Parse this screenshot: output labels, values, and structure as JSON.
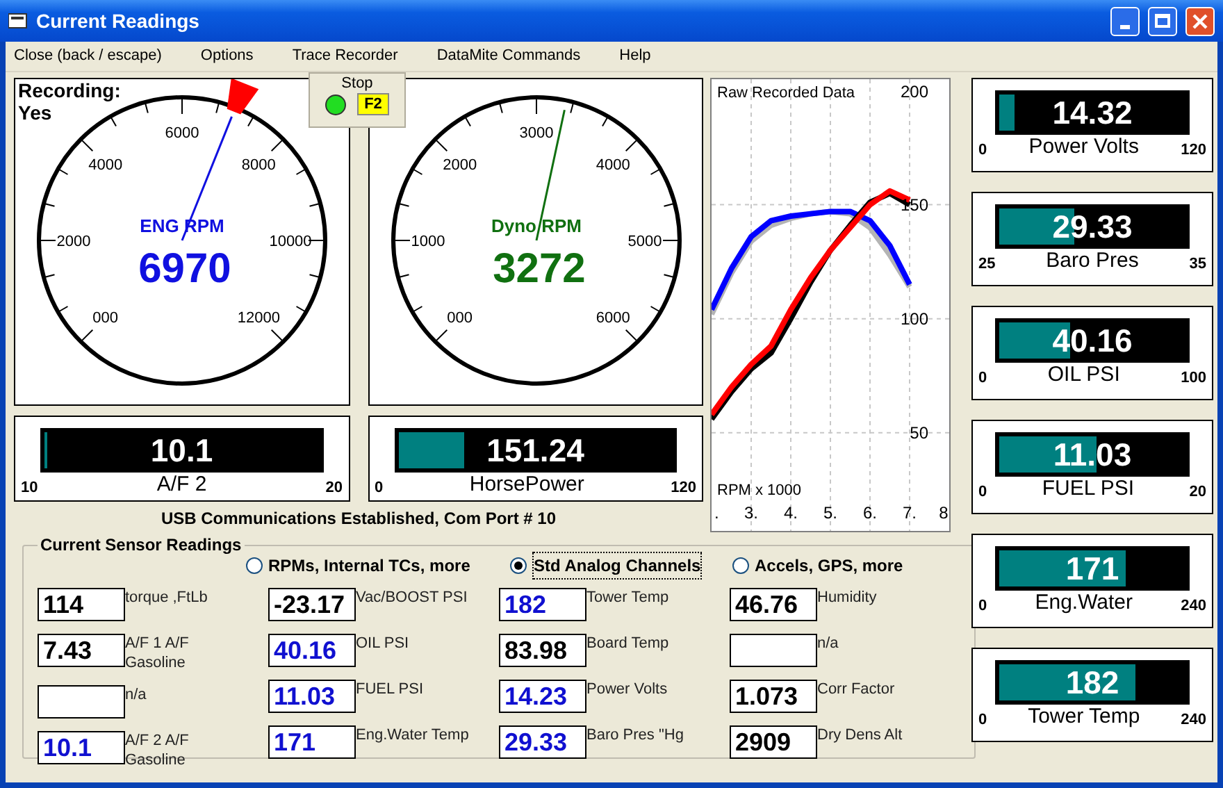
{
  "window": {
    "title": "Current Readings"
  },
  "menu": [
    "Close (back / escape)",
    "Options",
    "Trace Recorder",
    "DataMite Commands",
    "Help"
  ],
  "recorder_popup": {
    "label": "Stop",
    "running": true,
    "key": "F2"
  },
  "gauges": [
    {
      "label": "ENG RPM",
      "value": "6970",
      "color": "#1010e0",
      "level": 0.581,
      "marker": true,
      "status_label": "Recording:",
      "status_value": "Yes",
      "tick_labels": [
        "000",
        "2000",
        "4000",
        "6000",
        "8000",
        "10000",
        "12000"
      ]
    },
    {
      "label": "Dyno RPM",
      "value": "3272",
      "color": "#107010",
      "level": 0.545,
      "marker": false,
      "tick_labels": [
        "000",
        "1000",
        "2000",
        "3000",
        "4000",
        "5000",
        "6000"
      ]
    }
  ],
  "bars": [
    {
      "label": "A/F 2",
      "value": "10.1",
      "min": "10",
      "max": "20",
      "level": 0.01
    },
    {
      "label": "HorsePower",
      "value": "151.24",
      "min": "0",
      "max": "120",
      "level": 0.24
    }
  ],
  "status_text": "USB Communications Established, Com Port # 10",
  "chart": {
    "chart_data": {
      "type": "line",
      "title": "Raw Recorded Data",
      "xlabel": "RPM x 1000",
      "x": [
        2,
        2.5,
        3,
        3.5,
        4,
        4.5,
        5,
        5.5,
        6,
        6.5,
        7
      ],
      "xlim": [
        2,
        8
      ],
      "ylim": [
        7,
        205
      ],
      "grid": true,
      "xticks": [
        {
          "value": 2,
          "label": "."
        },
        {
          "value": 3,
          "label": "3."
        },
        {
          "value": 4,
          "label": "4."
        },
        {
          "value": 5,
          "label": "5."
        },
        {
          "value": 6,
          "label": "6."
        },
        {
          "value": 7,
          "label": "7."
        },
        {
          "value": 8,
          "label": "8"
        }
      ],
      "yticks": [
        50,
        100,
        150,
        200
      ],
      "series": [
        {
          "color": "#b4b4b4",
          "values": [
            102,
            120,
            134,
            141,
            144,
            146,
            147,
            146,
            140,
            128,
            114
          ]
        },
        {
          "color": "#0000ff",
          "values": [
            104,
            122,
            136,
            143,
            145,
            146,
            147,
            147,
            143,
            132,
            115
          ]
        },
        {
          "color": "#000000",
          "values": [
            56,
            68,
            78,
            85,
            100,
            116,
            130,
            141,
            151,
            155,
            150
          ]
        },
        {
          "color": "#ff0000",
          "values": [
            58,
            70,
            80,
            88,
            104,
            118,
            130,
            140,
            150,
            156,
            152
          ]
        }
      ]
    }
  },
  "sensor_readings": {
    "title": "Current Sensor Readings",
    "options": [
      {
        "label": "RPMs, Internal TCs, more",
        "selected": false
      },
      {
        "label": "Std Analog Channels",
        "selected": true
      },
      {
        "label": "Accels, GPS, more",
        "selected": false
      }
    ],
    "columns": [
      [
        {
          "value": "114",
          "label": "torque ,FtLb",
          "color": "#000000"
        },
        {
          "value": "7.43",
          "label": "A/F 1  A/F Gasoline",
          "color": "#000000"
        },
        {
          "label": "n/a"
        },
        {
          "value": "10.1",
          "label": "A/F 2  A/F Gasoline",
          "color": "#1010d0"
        }
      ],
      [
        {
          "value": "-23.17",
          "label": "Vac/BOOST PSI",
          "color": "#000000"
        },
        {
          "value": "40.16",
          "label": "OIL PSI",
          "color": "#1010d0"
        },
        {
          "value": "11.03",
          "label": "FUEL PSI",
          "color": "#1010d0"
        },
        {
          "value": "171",
          "label": "Eng.Water Temp",
          "color": "#1010d0"
        }
      ],
      [
        {
          "value": "182",
          "label": "Tower Temp",
          "color": "#1010d0"
        },
        {
          "value": "83.98",
          "label": "Board Temp",
          "color": "#000000"
        },
        {
          "value": "14.23",
          "label": "Power Volts",
          "color": "#1010d0"
        },
        {
          "value": "29.33",
          "label": "Baro Pres \"Hg",
          "color": "#1010d0"
        }
      ],
      [
        {
          "value": "46.76",
          "label": "Humidity",
          "color": "#000000"
        },
        {
          "label": "n/a"
        },
        {
          "value": "1.073",
          "label": "Corr Factor",
          "color": "#000000"
        },
        {
          "value": "2909",
          "label": "Dry Dens Alt",
          "color": "#000000"
        }
      ]
    ]
  },
  "side_bars": [
    {
      "label": "Power Volts",
      "value": "14.32",
      "min": "0",
      "max": "120",
      "level": 0.08
    },
    {
      "label": "Baro Pres",
      "value": "29.33",
      "min": "25",
      "max": "35",
      "level": 0.4
    },
    {
      "label": "OIL PSI",
      "value": "40.16",
      "min": "0",
      "max": "100",
      "level": 0.38
    },
    {
      "label": "FUEL PSI",
      "value": "11.03",
      "min": "0",
      "max": "20",
      "level": 0.52
    },
    {
      "label": "Eng.Water",
      "value": "171",
      "min": "0",
      "max": "240",
      "level": 0.68
    },
    {
      "label": "Tower Temp",
      "value": "182",
      "min": "0",
      "max": "240",
      "level": 0.73
    }
  ]
}
